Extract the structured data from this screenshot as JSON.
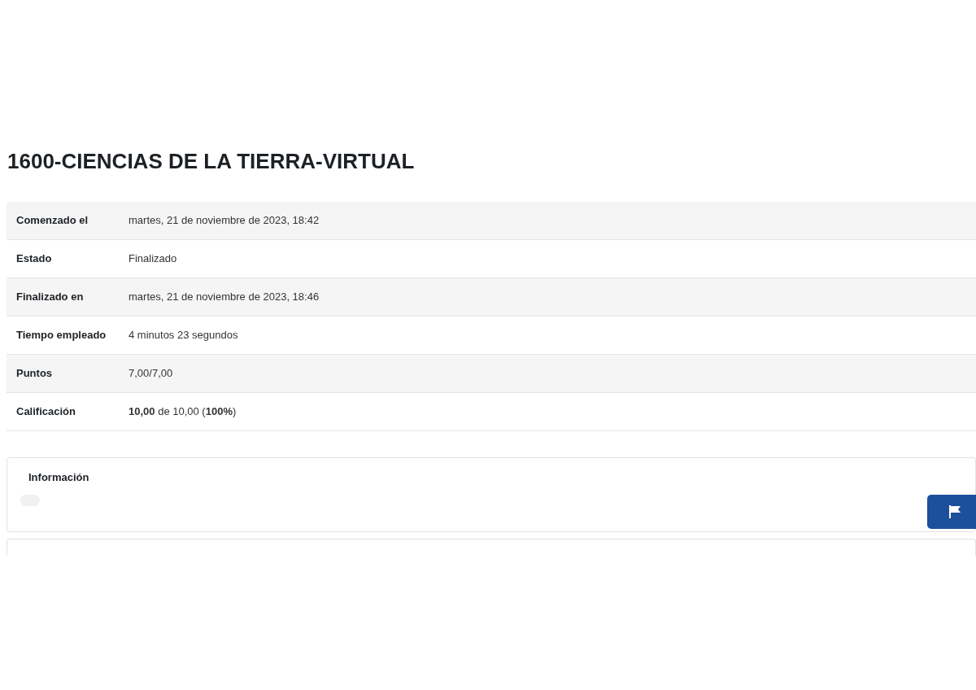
{
  "title": "1600-CIENCIAS DE LA TIERRA-VIRTUAL",
  "summary": [
    {
      "label": "Comenzado el",
      "value": "martes, 21 de noviembre de 2023, 18:42"
    },
    {
      "label": "Estado",
      "value": "Finalizado"
    },
    {
      "label": "Finalizado en",
      "value": "martes, 21 de noviembre de 2023, 18:46"
    },
    {
      "label": "Tiempo empleado",
      "value": "4 minutos 23 segundos"
    },
    {
      "label": "Puntos",
      "value": "7,00/7,00"
    },
    {
      "label": "Calificación",
      "value": "**10,00** de 10,00 (**100%**)"
    }
  ],
  "info_card": {
    "title": "Información"
  }
}
